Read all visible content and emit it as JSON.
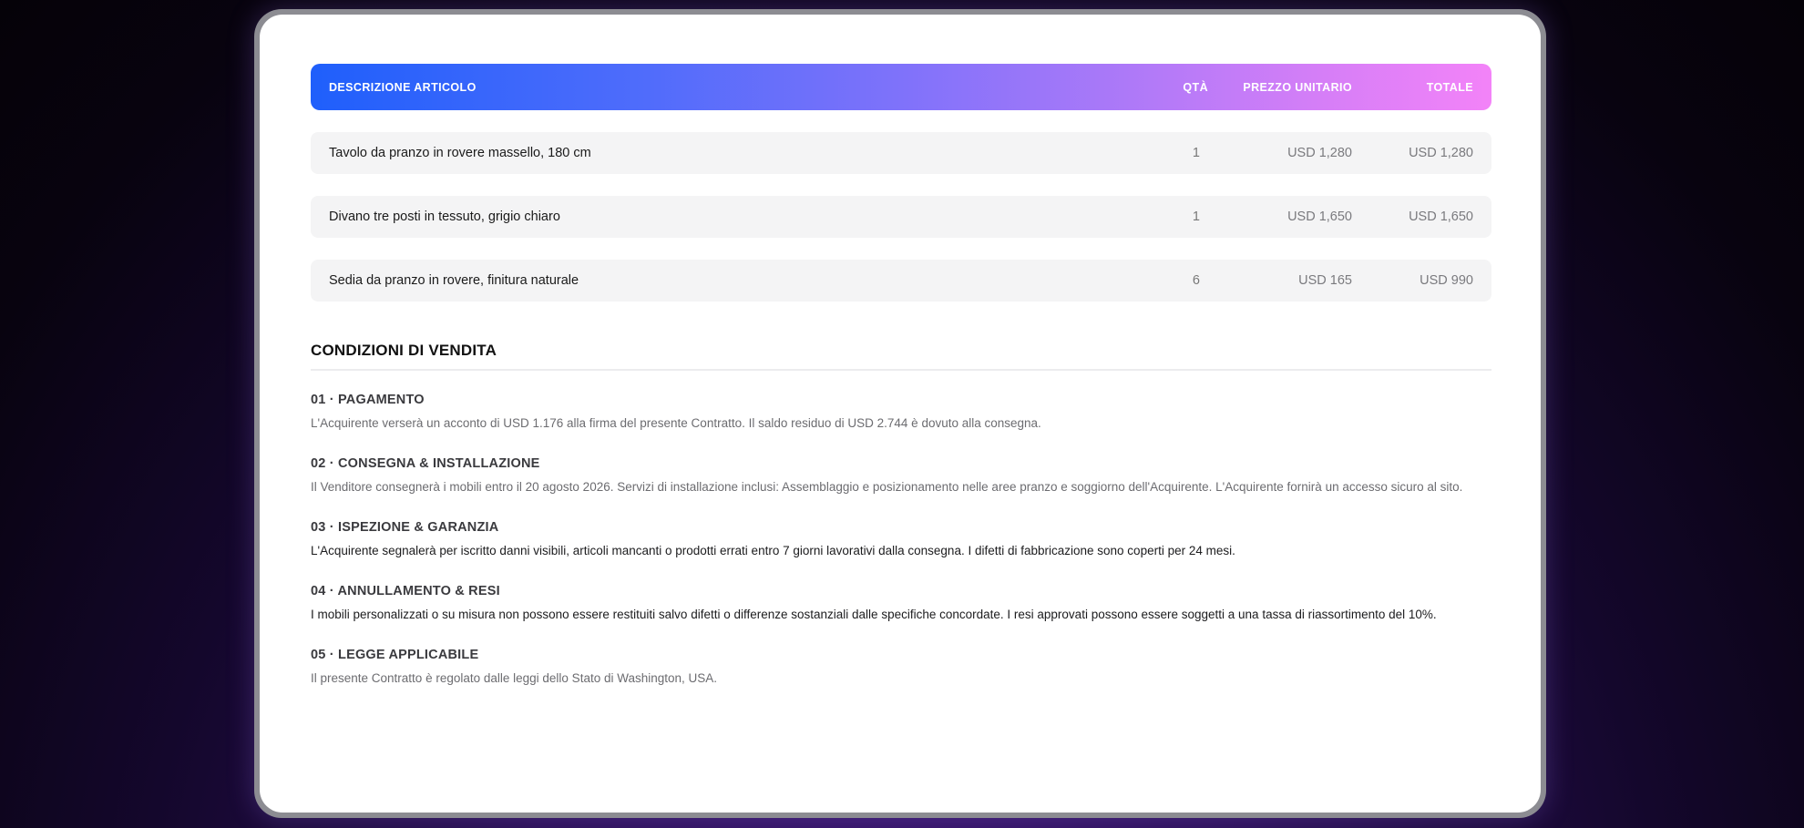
{
  "table": {
    "headers": {
      "description": "DESCRIZIONE ARTICOLO",
      "quantity": "QTÀ",
      "unit_price": "PREZZO UNITARIO",
      "total": "TOTALE"
    },
    "rows": [
      {
        "description": "Tavolo da pranzo in rovere massello, 180 cm",
        "quantity": "1",
        "unit_price": "USD 1,280",
        "total": "USD 1,280"
      },
      {
        "description": "Divano tre posti in tessuto, grigio chiaro",
        "quantity": "1",
        "unit_price": "USD 1,650",
        "total": "USD 1,650"
      },
      {
        "description": "Sedia da pranzo in rovere, finitura naturale",
        "quantity": "6",
        "unit_price": "USD 165",
        "total": "USD 990"
      }
    ]
  },
  "terms": {
    "title": "CONDIZIONI DI VENDITA",
    "clauses": [
      {
        "title": "01 · PAGAMENTO",
        "body": "L'Acquirente verserà un acconto di USD 1.176 alla firma del presente Contratto. Il saldo residuo di USD 2.744 è dovuto alla consegna."
      },
      {
        "title": "02 · CONSEGNA & INSTALLAZIONE",
        "body": "Il Venditore consegnerà i mobili entro il 20 agosto 2026. Servizi di installazione inclusi: Assemblaggio e posizionamento nelle aree pranzo e soggiorno dell'Acquirente. L'Acquirente fornirà un accesso sicuro al sito."
      },
      {
        "title": "03 · ISPEZIONE & GARANZIA",
        "body": "L'Acquirente segnalerà per iscritto danni visibili, articoli mancanti o prodotti errati entro 7 giorni lavorativi dalla consegna. I difetti di fabbricazione sono coperti per 24 mesi."
      },
      {
        "title": "04 · ANNULLAMENTO & RESI",
        "body": "I mobili personalizzati o su misura non possono essere restituiti salvo difetti o differenze sostanziali dalle specifiche concordate. I resi approvati possono essere soggetti a una tassa di riassortimento del 10%."
      },
      {
        "title": "05 · LEGGE APPLICABILE",
        "body": "Il presente Contratto è regolato dalle leggi dello Stato di Washington, USA."
      }
    ]
  },
  "colors": {
    "header_gradient_start": "#1f5ffb",
    "header_gradient_end": "#f383f8",
    "row_background": "#f4f4f5",
    "background": "#14072c"
  }
}
